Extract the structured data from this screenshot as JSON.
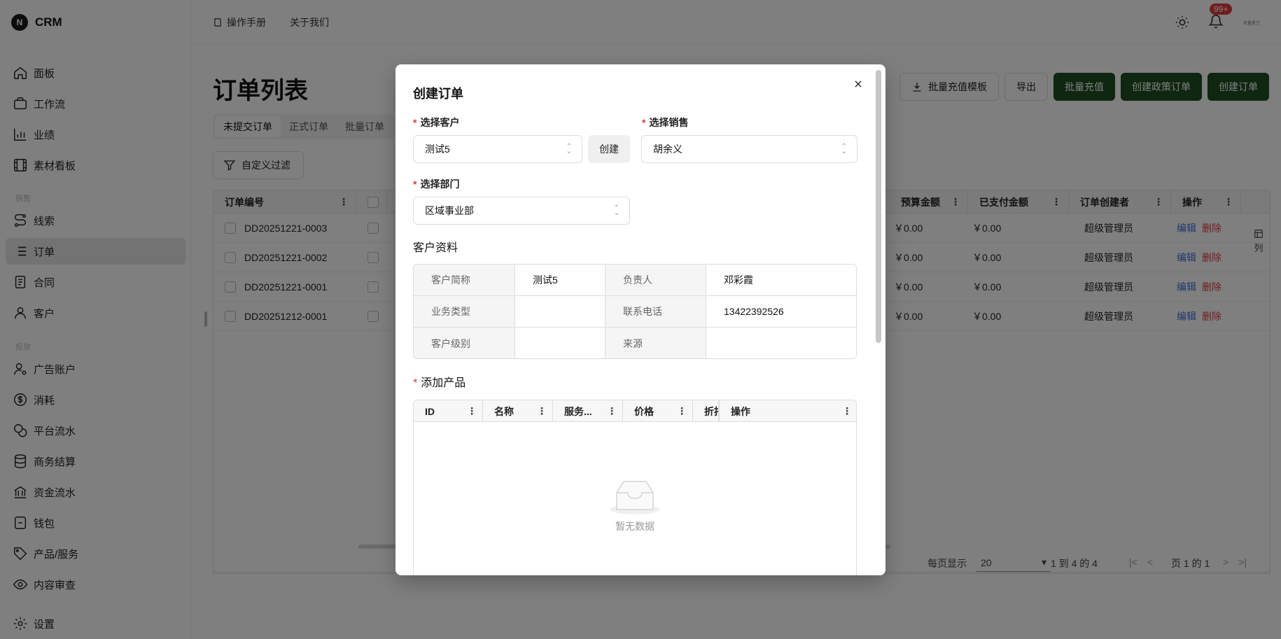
{
  "app": {
    "logo_mark": "N",
    "name": "CRM"
  },
  "sidebar": {
    "group1_label": "销售",
    "group2_label": "投放",
    "items": [
      {
        "label": "面板",
        "icon": "home-icon"
      },
      {
        "label": "工作流",
        "icon": "briefcase-icon"
      },
      {
        "label": "业绩",
        "icon": "bar-chart-icon"
      },
      {
        "label": "素材看板",
        "icon": "film-icon"
      },
      {
        "label": "线索",
        "icon": "route-icon"
      },
      {
        "label": "订单",
        "icon": "list-icon"
      },
      {
        "label": "合同",
        "icon": "clipboard-icon"
      },
      {
        "label": "客户",
        "icon": "user-icon"
      },
      {
        "label": "广告账户",
        "icon": "user-cog-icon"
      },
      {
        "label": "消耗",
        "icon": "dollar-circle-icon"
      },
      {
        "label": "平台流水",
        "icon": "coins-icon"
      },
      {
        "label": "商务结算",
        "icon": "database-icon"
      },
      {
        "label": "资金流水",
        "icon": "bank-icon"
      },
      {
        "label": "钱包",
        "icon": "wallet-icon"
      },
      {
        "label": "产品/服务",
        "icon": "tag-icon"
      },
      {
        "label": "内容审查",
        "icon": "eye-icon"
      },
      {
        "label": "设置",
        "icon": "gear-icon"
      }
    ],
    "active_item": "订单"
  },
  "topbar": {
    "manual_label": "操作手册",
    "about_label": "关于我们",
    "notification_count": "99+",
    "avatar_text": "巨量星空"
  },
  "page": {
    "title": "订单列表",
    "tabs": [
      "未提交订单",
      "正式订单",
      "批量订单"
    ],
    "active_tab": "未提交订单",
    "filter_label": "自定义过滤",
    "buttons": {
      "bulk_template": "批量充值模板",
      "export": "导出",
      "bulk_recharge": "批量充值",
      "create_policy_order": "创建政策订单",
      "create_order": "创建订单"
    }
  },
  "grid": {
    "columns_left": [
      "订单编号"
    ],
    "columns_right": [
      "预算金额",
      "已支付金额",
      "订单创建者",
      "操作"
    ],
    "rows": [
      {
        "id": "DD20251221-0003",
        "budget": "￥0.00",
        "paid": "￥0.00",
        "creator": "超级管理员"
      },
      {
        "id": "DD20251221-0002",
        "budget": "￥0.00",
        "paid": "￥0.00",
        "creator": "超级管理员"
      },
      {
        "id": "DD20251221-0001",
        "budget": "￥0.00",
        "paid": "￥0.00",
        "creator": "超级管理员"
      },
      {
        "id": "DD20251212-0001",
        "budget": "￥0.00",
        "paid": "￥0.00",
        "creator": "超级管理员"
      }
    ],
    "edit_label": "编辑",
    "delete_label": "删除",
    "columns_toggle": "列",
    "footer": {
      "page_size_label": "每页显示",
      "page_size": "20",
      "range": "1 到 4 的 4",
      "page_info": "页 1 的 1"
    }
  },
  "modal": {
    "title": "创建订单",
    "customer_label": "选择客户",
    "customer_value": "测试5",
    "create_customer": "创建",
    "sales_label": "选择销售",
    "sales_value": "胡余义",
    "dept_label": "选择部门",
    "dept_value": "区域事业部",
    "customer_info_title": "客户资料",
    "customer_info": {
      "short_name_label": "客户简称",
      "short_name": "测试5",
      "owner_label": "负责人",
      "owner": "邓彩霞",
      "biz_type_label": "业务类型",
      "biz_type": "",
      "phone_label": "联系电话",
      "phone": "13422392526",
      "level_label": "客户级别",
      "level": "",
      "source_label": "来源",
      "source": ""
    },
    "products_title": "添加产品",
    "product_columns": [
      "ID",
      "名称",
      "服务...",
      "价格",
      "折扣",
      "操作"
    ],
    "empty_text": "暂无数据"
  },
  "colors": {
    "brand_green": "#1f4d20",
    "danger": "#e23b3b",
    "link": "#3a6fd8"
  }
}
